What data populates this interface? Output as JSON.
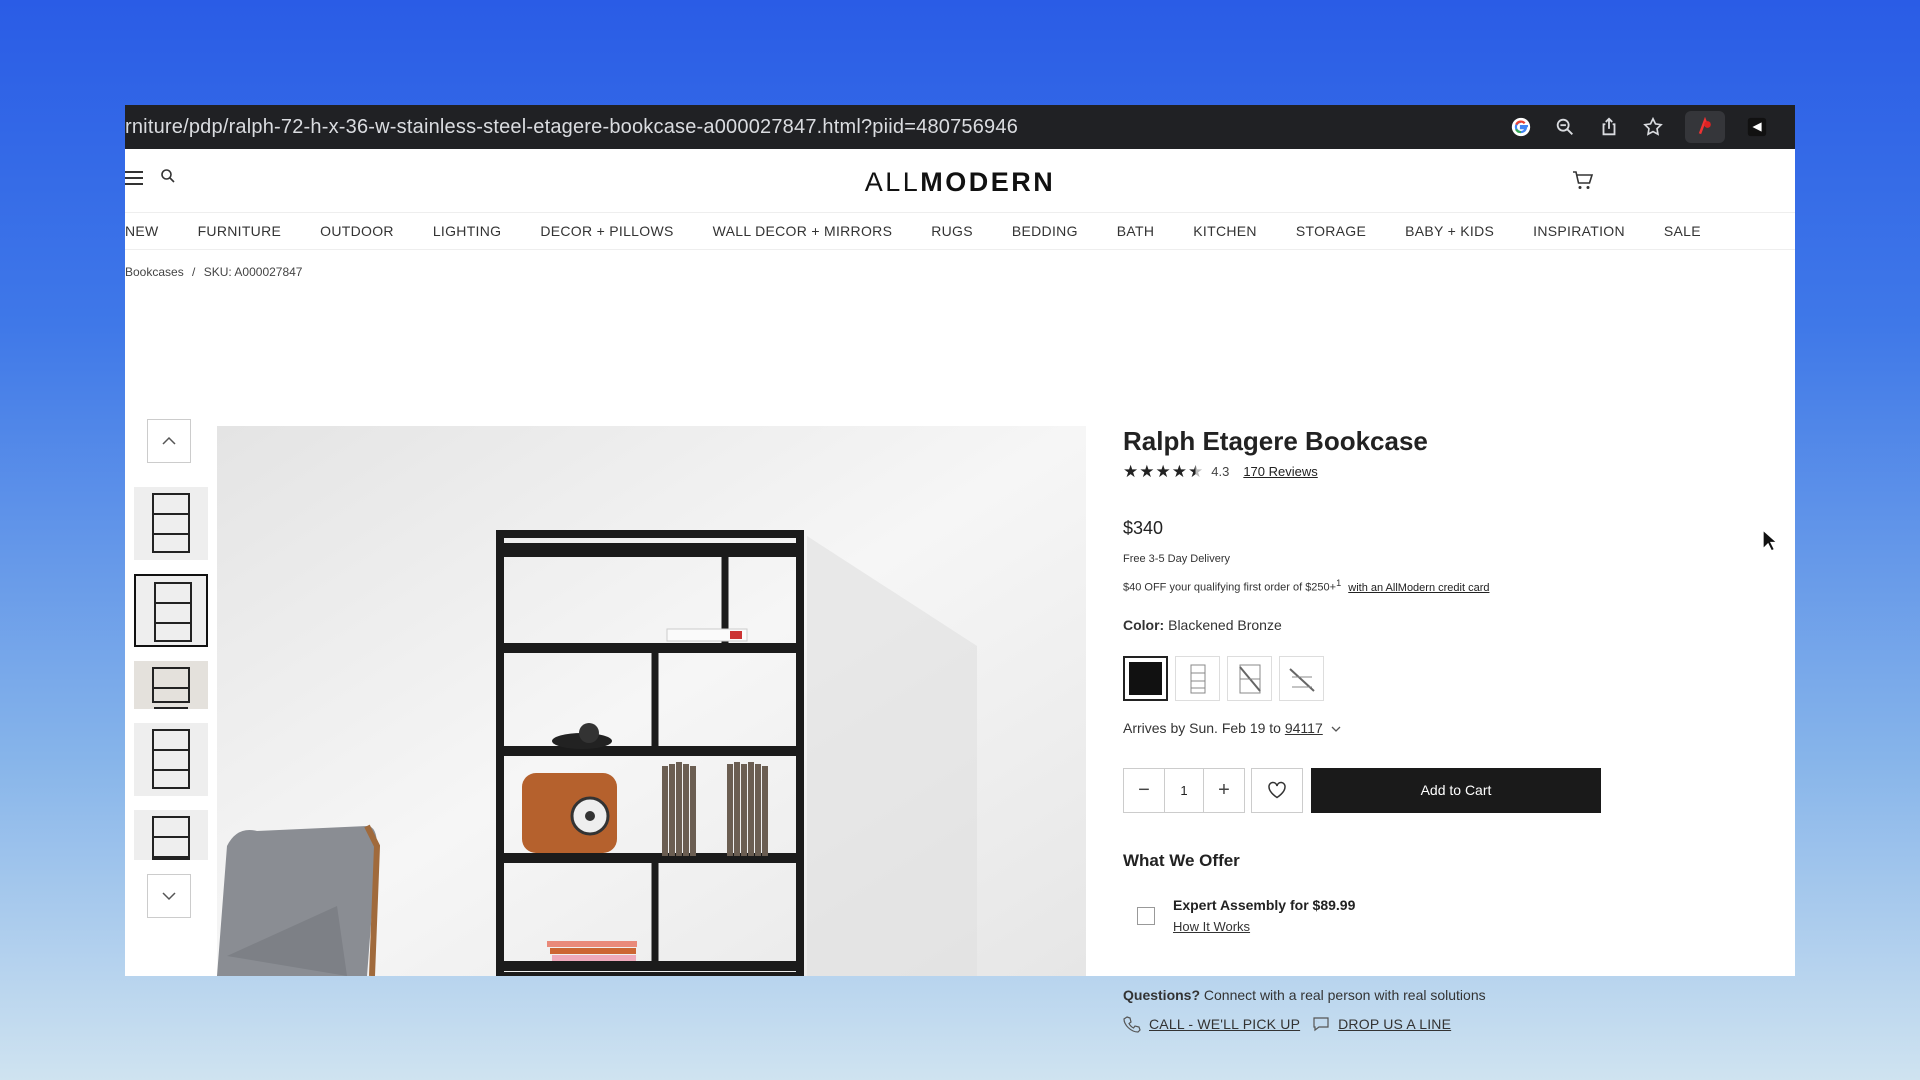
{
  "browser": {
    "url": "rniture/pdp/ralph-72-h-x-36-w-stainless-steel-etagere-bookcase-a000027847.html?piid=480756946"
  },
  "site": {
    "logo_light": "ALL",
    "logo_bold": "MODERN"
  },
  "nav": {
    "items": [
      "NEW",
      "FURNITURE",
      "OUTDOOR",
      "LIGHTING",
      "DECOR + PILLOWS",
      "WALL DECOR + MIRRORS",
      "RUGS",
      "BEDDING",
      "BATH",
      "KITCHEN",
      "STORAGE",
      "BABY + KIDS",
      "INSPIRATION",
      "SALE"
    ]
  },
  "breadcrumb": {
    "category": "Bookcases",
    "separator": "/",
    "sku": "SKU: A000027847"
  },
  "product": {
    "title": "Ralph Etagere Bookcase",
    "rating": "4.3",
    "rating_value": 4.3,
    "reviews": "170 Reviews",
    "price": "$340",
    "delivery": "Free 3-5 Day Delivery",
    "promo_text": "$40 OFF your qualifying first order of $250+",
    "promo_sup": "1",
    "promo_link": "with an AllModern credit card",
    "color_label": "Color:",
    "color_value": "Blackened Bronze",
    "arrives_text": "Arrives by Sun. Feb 19 to",
    "zip": "94117",
    "quantity": "1",
    "add_to_cart": "Add to Cart"
  },
  "offer": {
    "title": "What We Offer",
    "assembly": "Expert Assembly for $89.99",
    "how_it_works": "How It Works"
  },
  "questions": {
    "label": "Questions?",
    "text": "Connect with a real person with real solutions",
    "call": "CALL - WE'LL PICK UP",
    "drop": "DROP US A LINE"
  },
  "colors": {
    "dark_bar": "#202124",
    "button": "#1a1a1a"
  }
}
